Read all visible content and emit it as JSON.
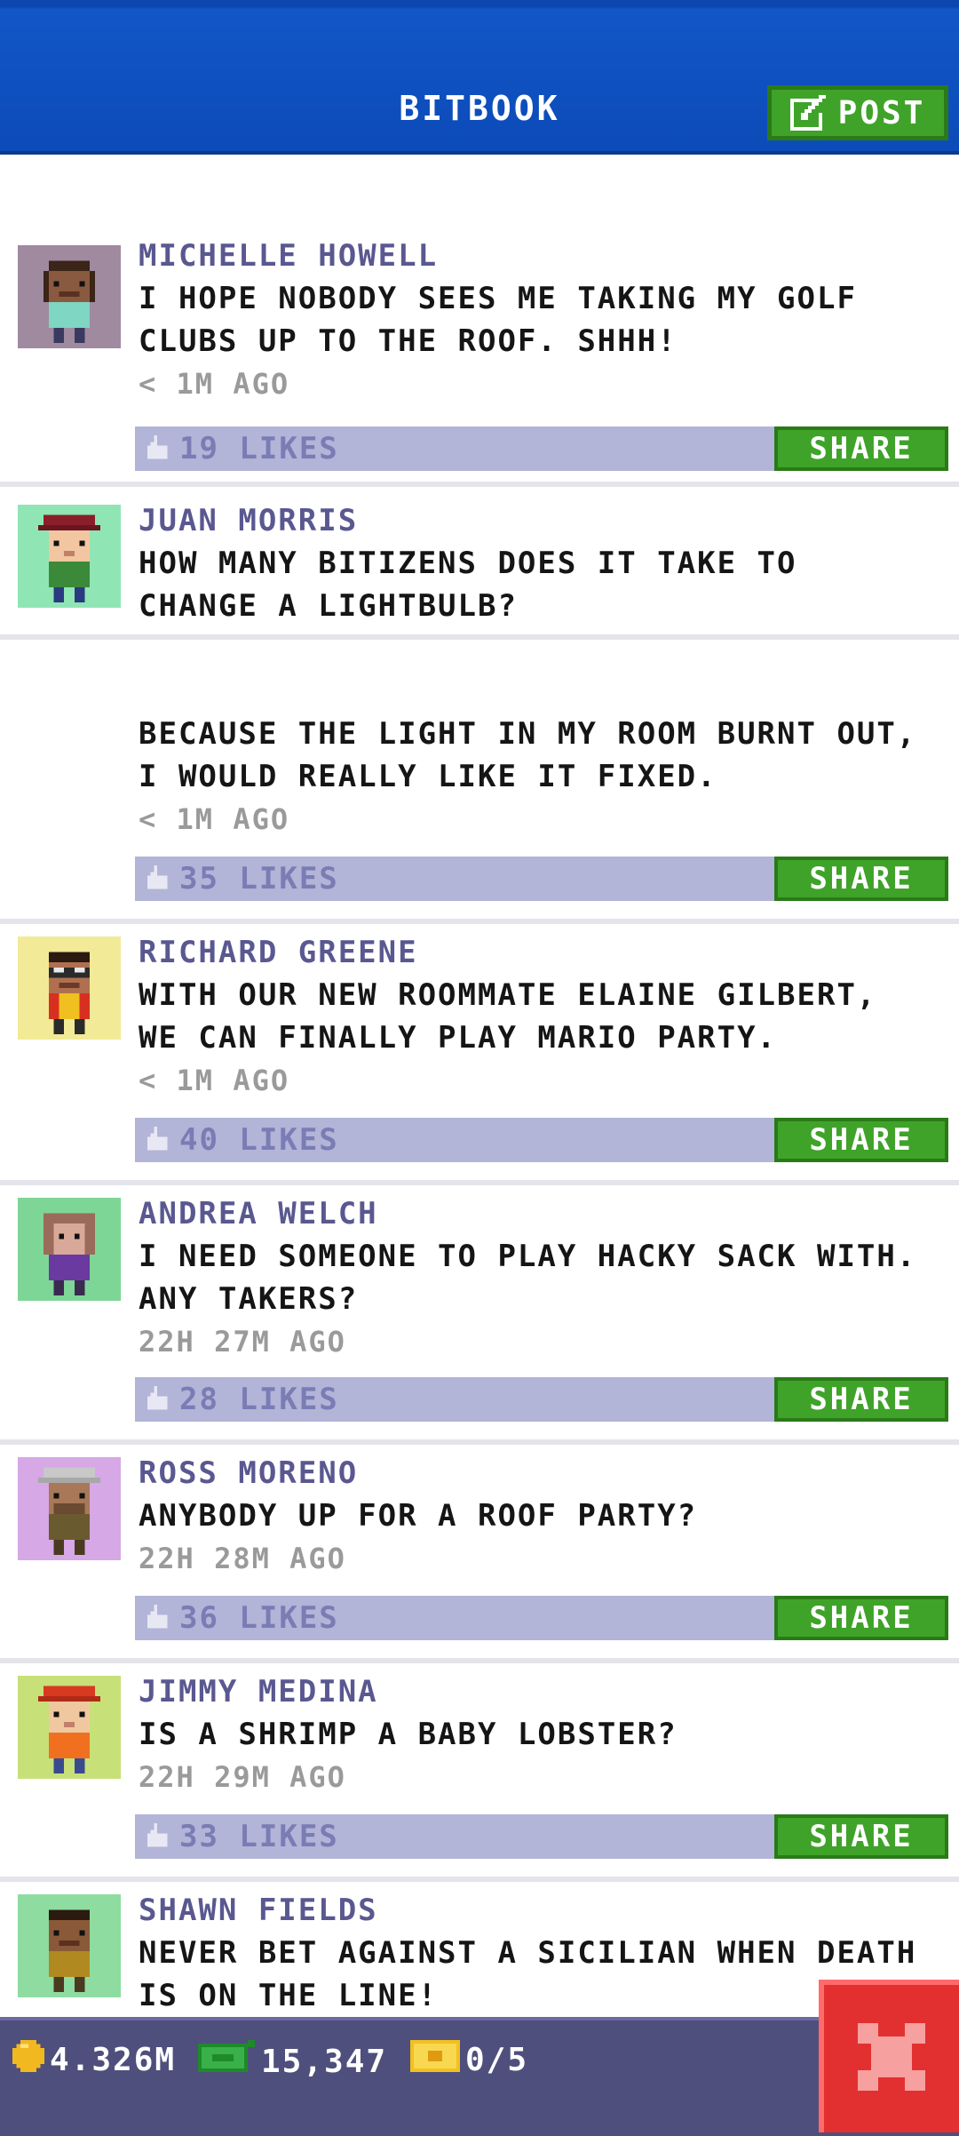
{
  "header": {
    "title": "BITBOOK",
    "post_label": "POST"
  },
  "posts": [
    {
      "author": "MICHELLE HOWELL",
      "message": "I HOPE NOBODY SEES ME TAKING MY GOLF\nCLUBS UP TO THE ROOF. SHHH!",
      "time": "< 1M AGO",
      "likes": "19 LIKES",
      "share": "SHARE"
    },
    {
      "author": "JUAN MORRIS",
      "message": "HOW MANY BITIZENS DOES IT TAKE TO\nCHANGE A LIGHTBULB?\n\n\nBECAUSE THE LIGHT IN MY ROOM BURNT OUT,\nI WOULD REALLY LIKE IT FIXED.",
      "time": "< 1M AGO",
      "likes": "35 LIKES",
      "share": "SHARE"
    },
    {
      "author": "RICHARD GREENE",
      "message": "WITH OUR NEW ROOMMATE ELAINE GILBERT,\nWE CAN FINALLY PLAY MARIO PARTY.",
      "time": "< 1M AGO",
      "likes": "40 LIKES",
      "share": "SHARE"
    },
    {
      "author": "ANDREA WELCH",
      "message": "I NEED SOMEONE TO PLAY HACKY SACK WITH.\nANY TAKERS?",
      "time": "22H 27M AGO",
      "likes": "28 LIKES",
      "share": "SHARE"
    },
    {
      "author": "ROSS MORENO",
      "message": "ANYBODY UP FOR A ROOF PARTY?",
      "time": "22H 28M AGO",
      "likes": "36 LIKES",
      "share": "SHARE"
    },
    {
      "author": "JIMMY MEDINA",
      "message": "IS A SHRIMP A BABY LOBSTER?",
      "time": "22H 29M AGO",
      "likes": "33 LIKES",
      "share": "SHARE"
    },
    {
      "author": "SHAWN FIELDS",
      "message": "NEVER BET AGAINST A SICILIAN WHEN DEATH\nIS ON THE LINE!",
      "time": "",
      "likes": "",
      "share": ""
    }
  ],
  "status": {
    "coins": "4.326M",
    "bux": "15,347",
    "tickets": "0/5"
  },
  "colors": {
    "header": "#0c4bb8",
    "accent_green": "#3fa329",
    "likes_bar": "#b2b4d8",
    "author": "#5a5890",
    "close_red": "#e23030"
  },
  "icons": {
    "post": "edit-icon",
    "likes": "thumb-up-icon",
    "coins": "coin-icon",
    "bux": "bux-icon",
    "tickets": "ticket-icon",
    "close": "close-icon"
  }
}
